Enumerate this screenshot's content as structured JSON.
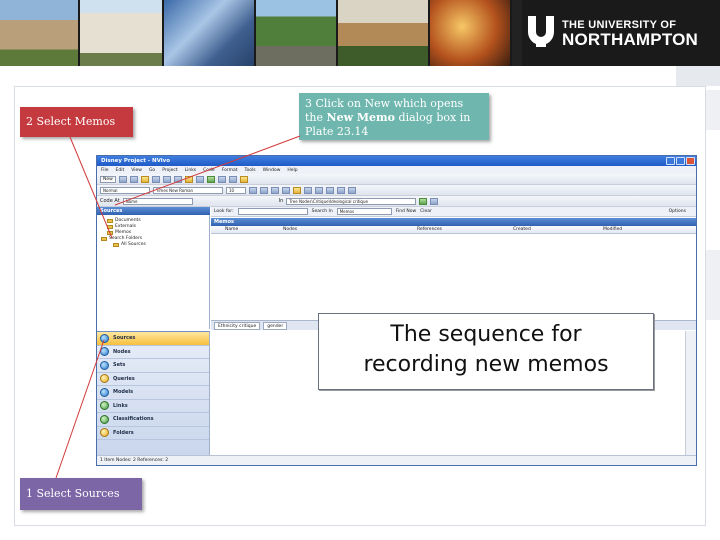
{
  "banner": {
    "logo_top": "THE UNIVERSITY OF",
    "logo_bottom": "NORTHAMPTON"
  },
  "callouts": {
    "step2": "2 Select Memos",
    "step3_line1": "3 Click on New which opens",
    "step3_line2_pre": "the ",
    "step3_line2_bold": "New Memo",
    "step3_line2_post": " dialog box in",
    "step3_line3": "Plate 23.14",
    "step1": "1 Select Sources"
  },
  "app": {
    "title": "Disney Project - NVivo",
    "menu": [
      "File",
      "Edit",
      "View",
      "Go",
      "Project",
      "Links",
      "Code",
      "Format",
      "Tools",
      "Window",
      "Help"
    ],
    "new_label": "New",
    "style_combo": "Normal",
    "font_combo": "Times New Roman",
    "size_combo": "10",
    "codeat_label": "Code At",
    "codeat_value": "Name",
    "in_label": "In",
    "in_value": "Tree Nodes\\Critique\\Ideological critique",
    "sources_header": "Sources",
    "tree": [
      "Documents",
      "Externals",
      "Memos",
      "Search Folders",
      "All Sources"
    ],
    "find": {
      "look_for": "Look for:",
      "search_in": "Search In",
      "search_value": "Memos",
      "find_now": "Find Now",
      "clear": "Clear",
      "options": "Options"
    },
    "memos_header": "Memos",
    "columns": [
      "Name",
      "Nodes",
      "References",
      "Created",
      "Modified"
    ],
    "doc_tabs": [
      "Ethnicity critique",
      "gender"
    ],
    "nav": [
      "Sources",
      "Nodes",
      "Sets",
      "Queries",
      "Models",
      "Links",
      "Classifications",
      "Folders"
    ],
    "status": "1 Item   Nodes: 2   References: 2"
  },
  "overlay": {
    "line1": "The sequence for",
    "line2": "recording new memos"
  },
  "colors": {
    "callout_red": "#c53a3f",
    "callout_teal": "#6fb7ae",
    "callout_purple": "#7c66a6",
    "arrow": "#d13b3b"
  }
}
